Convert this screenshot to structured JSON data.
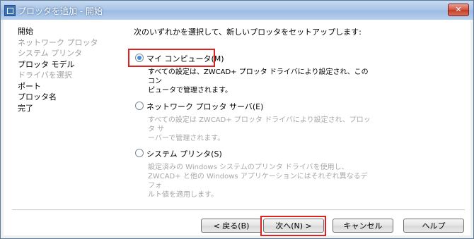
{
  "window": {
    "title": "プロッタを追加 - 開始",
    "close_label": "✕"
  },
  "nav": {
    "items": [
      {
        "label": "開始",
        "enabled": true
      },
      {
        "label": "ネットワーク プロッタ",
        "enabled": false
      },
      {
        "label": "システム プリンタ",
        "enabled": false
      },
      {
        "label": "プロッタ モデル",
        "enabled": true
      },
      {
        "label": "ドライバを選択",
        "enabled": false
      },
      {
        "label": "ポート",
        "enabled": true
      },
      {
        "label": "プロッタ名",
        "enabled": true
      },
      {
        "label": "完了",
        "enabled": true
      }
    ]
  },
  "main": {
    "instruction": "次のいずれかを選択して、新しいプロッタをセットアップします:",
    "options": [
      {
        "label": "マイ コンピュータ(M)",
        "checked": true,
        "desc1": "すべての設定は、ZWCAD+ プロッタ ドライバにより設定され、このコン",
        "desc2": "ピュータで管理されます。"
      },
      {
        "label": "ネットワーク プロッタ サーバ(E)",
        "checked": false,
        "desc1": "すべての設定は ZWCAD+ プロッタ ドライバにより設定され、プロッタ サ",
        "desc2": "ーバーで管理されます。"
      },
      {
        "label": "システム プリンタ(S)",
        "checked": false,
        "desc1": "設定済みの Windows システムのプリンタ ドライバを使用し、",
        "desc2": "ZWCAD+ と他の Windows アプリケーションにはそれぞれ異なるデフォ",
        "desc3": "ルト値を適用します。"
      }
    ]
  },
  "buttons": {
    "back": "< 戻る(B)",
    "next": "次へ(N) >",
    "cancel": "キャンセル",
    "help": "ヘルプ"
  }
}
